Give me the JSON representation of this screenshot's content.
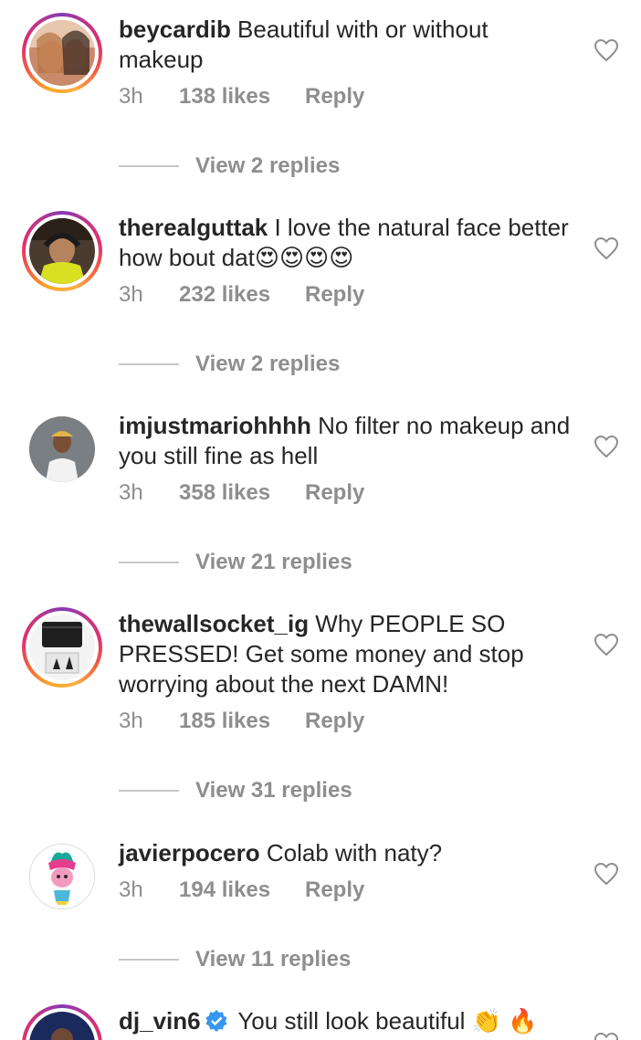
{
  "comments": [
    {
      "username": "beycardib",
      "text": " Beautiful with or without makeup",
      "time": "3h",
      "likes": "138 likes",
      "reply": "Reply",
      "view_replies": "View 2 replies"
    },
    {
      "username": "therealguttak",
      "text": " I love the natural face better how bout dat😍😍😍😍",
      "time": "3h",
      "likes": "232 likes",
      "reply": "Reply",
      "view_replies": "View 2 replies"
    },
    {
      "username": "imjustmariohhhh",
      "text": " No filter no makeup and you still fine as hell",
      "time": "3h",
      "likes": "358 likes",
      "reply": "Reply",
      "view_replies": "View 21 replies"
    },
    {
      "username": "thewallsocket_ig",
      "text": " Why PEOPLE SO PRESSED! Get some money and stop worrying about the next DAMN!",
      "time": "3h",
      "likes": "185 likes",
      "reply": "Reply",
      "view_replies": "View 31 replies"
    },
    {
      "username": "javierpocero",
      "text": " Colab with naty?",
      "time": "3h",
      "likes": "194 likes",
      "reply": "Reply",
      "view_replies": "View 11 replies"
    },
    {
      "username": "dj_vin6",
      "text": " You still look beautiful 👏 🔥"
    }
  ],
  "colors": {
    "text": "#262626",
    "secondary": "#8e8e8e",
    "verified": "#3897f0",
    "story_ring_start": "#f9a825",
    "story_ring_end": "#c13584"
  }
}
